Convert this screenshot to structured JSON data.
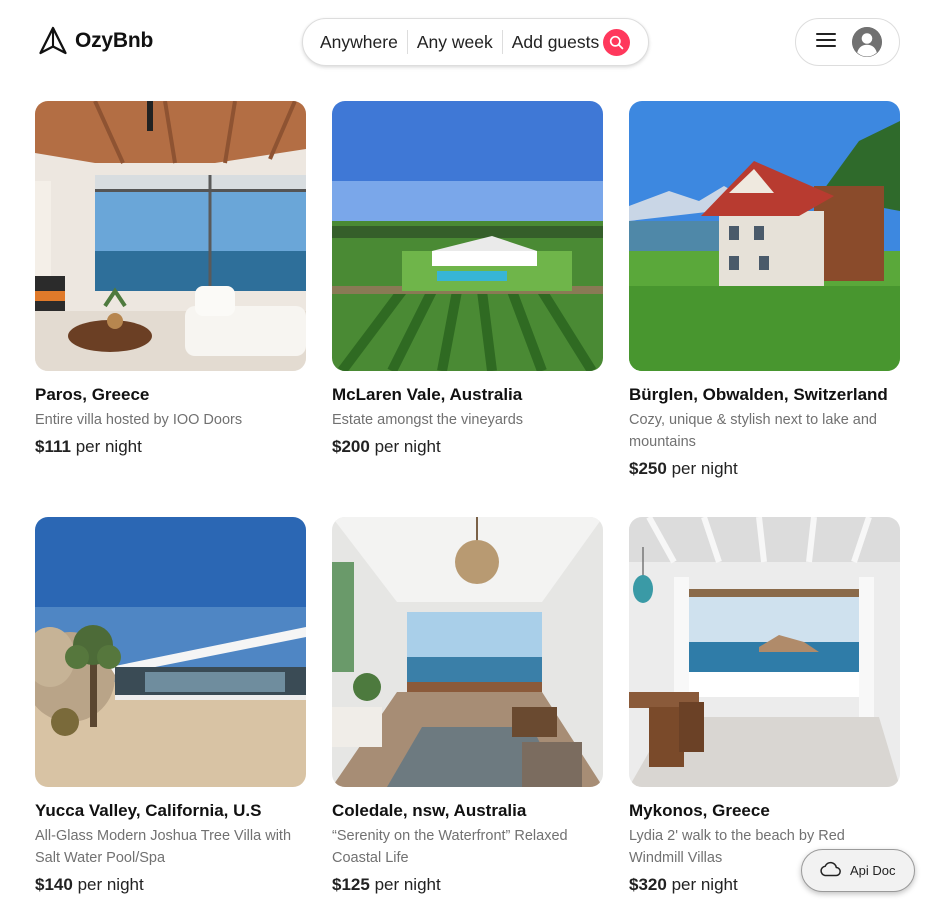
{
  "header": {
    "brand": "OzyBnb",
    "search": {
      "where": "Anywhere",
      "when": "Any week",
      "who": "Add guests"
    }
  },
  "listings": [
    {
      "title": "Paros, Greece",
      "description": "Entire villa hosted by IOO Doors",
      "price": "$111",
      "price_suffix": "per night",
      "photo": "modern-living-room-sea-view"
    },
    {
      "title": "McLaren Vale, Australia",
      "description": "Estate amongst the vineyards",
      "price": "$200",
      "price_suffix": "per night",
      "photo": "vineyard-estate-pool"
    },
    {
      "title": "Bürglen, Obwalden, Switzerland",
      "description": "Cozy, unique & stylish next to lake and mountains",
      "price": "$250",
      "price_suffix": "per night",
      "photo": "chalet-by-lake-mountains"
    },
    {
      "title": "Yucca Valley, California, U.S",
      "description": "All-Glass Modern Joshua Tree Villa with Salt Water Pool/Spa",
      "price": "$140",
      "price_suffix": "per night",
      "photo": "desert-glass-villa"
    },
    {
      "title": "Coledale, nsw, Australia",
      "description": "“Serenity on the Waterfront” Relaxed Coastal Life",
      "price": "$125",
      "price_suffix": "per night",
      "photo": "coastal-living-room"
    },
    {
      "title": "Mykonos, Greece",
      "description": "Lydia 2' walk to the beach by Red Windmill Villas",
      "price": "$320",
      "price_suffix": "per night",
      "photo": "white-dining-room-sea-view"
    }
  ],
  "api_doc": {
    "label": "Api Doc"
  },
  "colors": {
    "accent": "#ff385c",
    "text_primary": "#222222",
    "text_secondary": "#717171",
    "border": "#dddddd"
  }
}
